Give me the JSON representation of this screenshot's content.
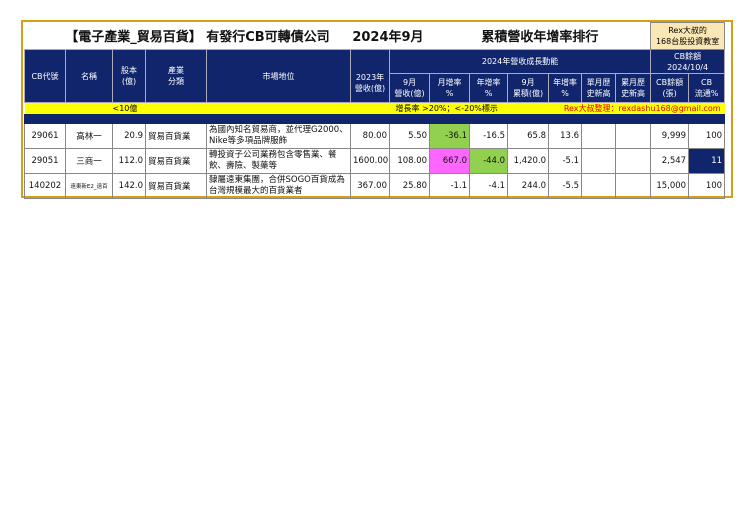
{
  "title": {
    "main": "【電子產業_貿易百貨】 有發行CB可轉債公司",
    "period": "2024年9月",
    "ranking": "累積營收年增率排行",
    "logo_line1": "Rex大叔的",
    "logo_line2": "168台股投資教室"
  },
  "headers": {
    "cb_code": "CB代號",
    "name": "名稱",
    "capital": "股本\n(億)",
    "industry": "產業\n分類",
    "market": "市場地位",
    "rev2023": "2023年\n營收(億)",
    "growth_group": "2024年營收成長動能",
    "cb_group_l1": "CB餘額",
    "cb_group_l2": "2024/10/4",
    "sep_rev": "9月\n營收(億)",
    "mom": "月增率\n%",
    "yoy": "年增率\n%",
    "cum": "9月\n累積(億)",
    "cum_yoy": "年增率\n%",
    "month_high": "單月歷\n史新高",
    "cum_high": "累月歷\n史新高",
    "cb_balance": "CB餘額\n(張)",
    "cb_float": "CB\n流通%"
  },
  "notes": {
    "small_cap": "<10億",
    "rule": "增長率 >20%；<-20%標示",
    "credit": "Rex大叔整理：rexdashu168@gmail.com"
  },
  "rows": [
    {
      "code": "29061",
      "name": "高林一",
      "capital": "20.9",
      "industry": "貿易百貨業",
      "market": "為國內知名貿易商，並代理G2000、Nike等多項品牌服飾",
      "rev2023": "80.00",
      "sep_rev": "5.50",
      "mom": "-36.1",
      "yoy": "-16.5",
      "cum": "65.8",
      "cum_yoy": "13.6",
      "month_high": "",
      "cum_high": "",
      "cb_balance": "9,999",
      "cb_float": "100"
    },
    {
      "code": "29051",
      "name": "三商一",
      "capital": "112.0",
      "industry": "貿易百貨業",
      "market": "轉投資子公司業務包含零售業、餐飲、壽險、製藥等",
      "rev2023": "1600.00",
      "sep_rev": "108.00",
      "mom": "667.0",
      "yoy": "-44.0",
      "cum": "1,420.0",
      "cum_yoy": "-5.1",
      "month_high": "",
      "cum_high": "",
      "cb_balance": "2,547",
      "cb_float": "11"
    },
    {
      "code": "140202",
      "name": "遠東新E2_遠百",
      "capital": "142.0",
      "industry": "貿易百貨業",
      "market": "隸屬遠東集團，合併SOGO百貨成為台灣規模最大的百貨業者",
      "rev2023": "367.00",
      "sep_rev": "25.80",
      "mom": "-1.1",
      "yoy": "-4.1",
      "cum": "244.0",
      "cum_yoy": "-5.5",
      "month_high": "",
      "cum_high": "",
      "cb_balance": "15,000",
      "cb_float": "100"
    }
  ],
  "colors": {
    "header": "#10256b",
    "highlight_up": "#ff66ff",
    "highlight_down": "#92d050",
    "note_bar": "#ffff00",
    "frame": "#d4a017"
  }
}
